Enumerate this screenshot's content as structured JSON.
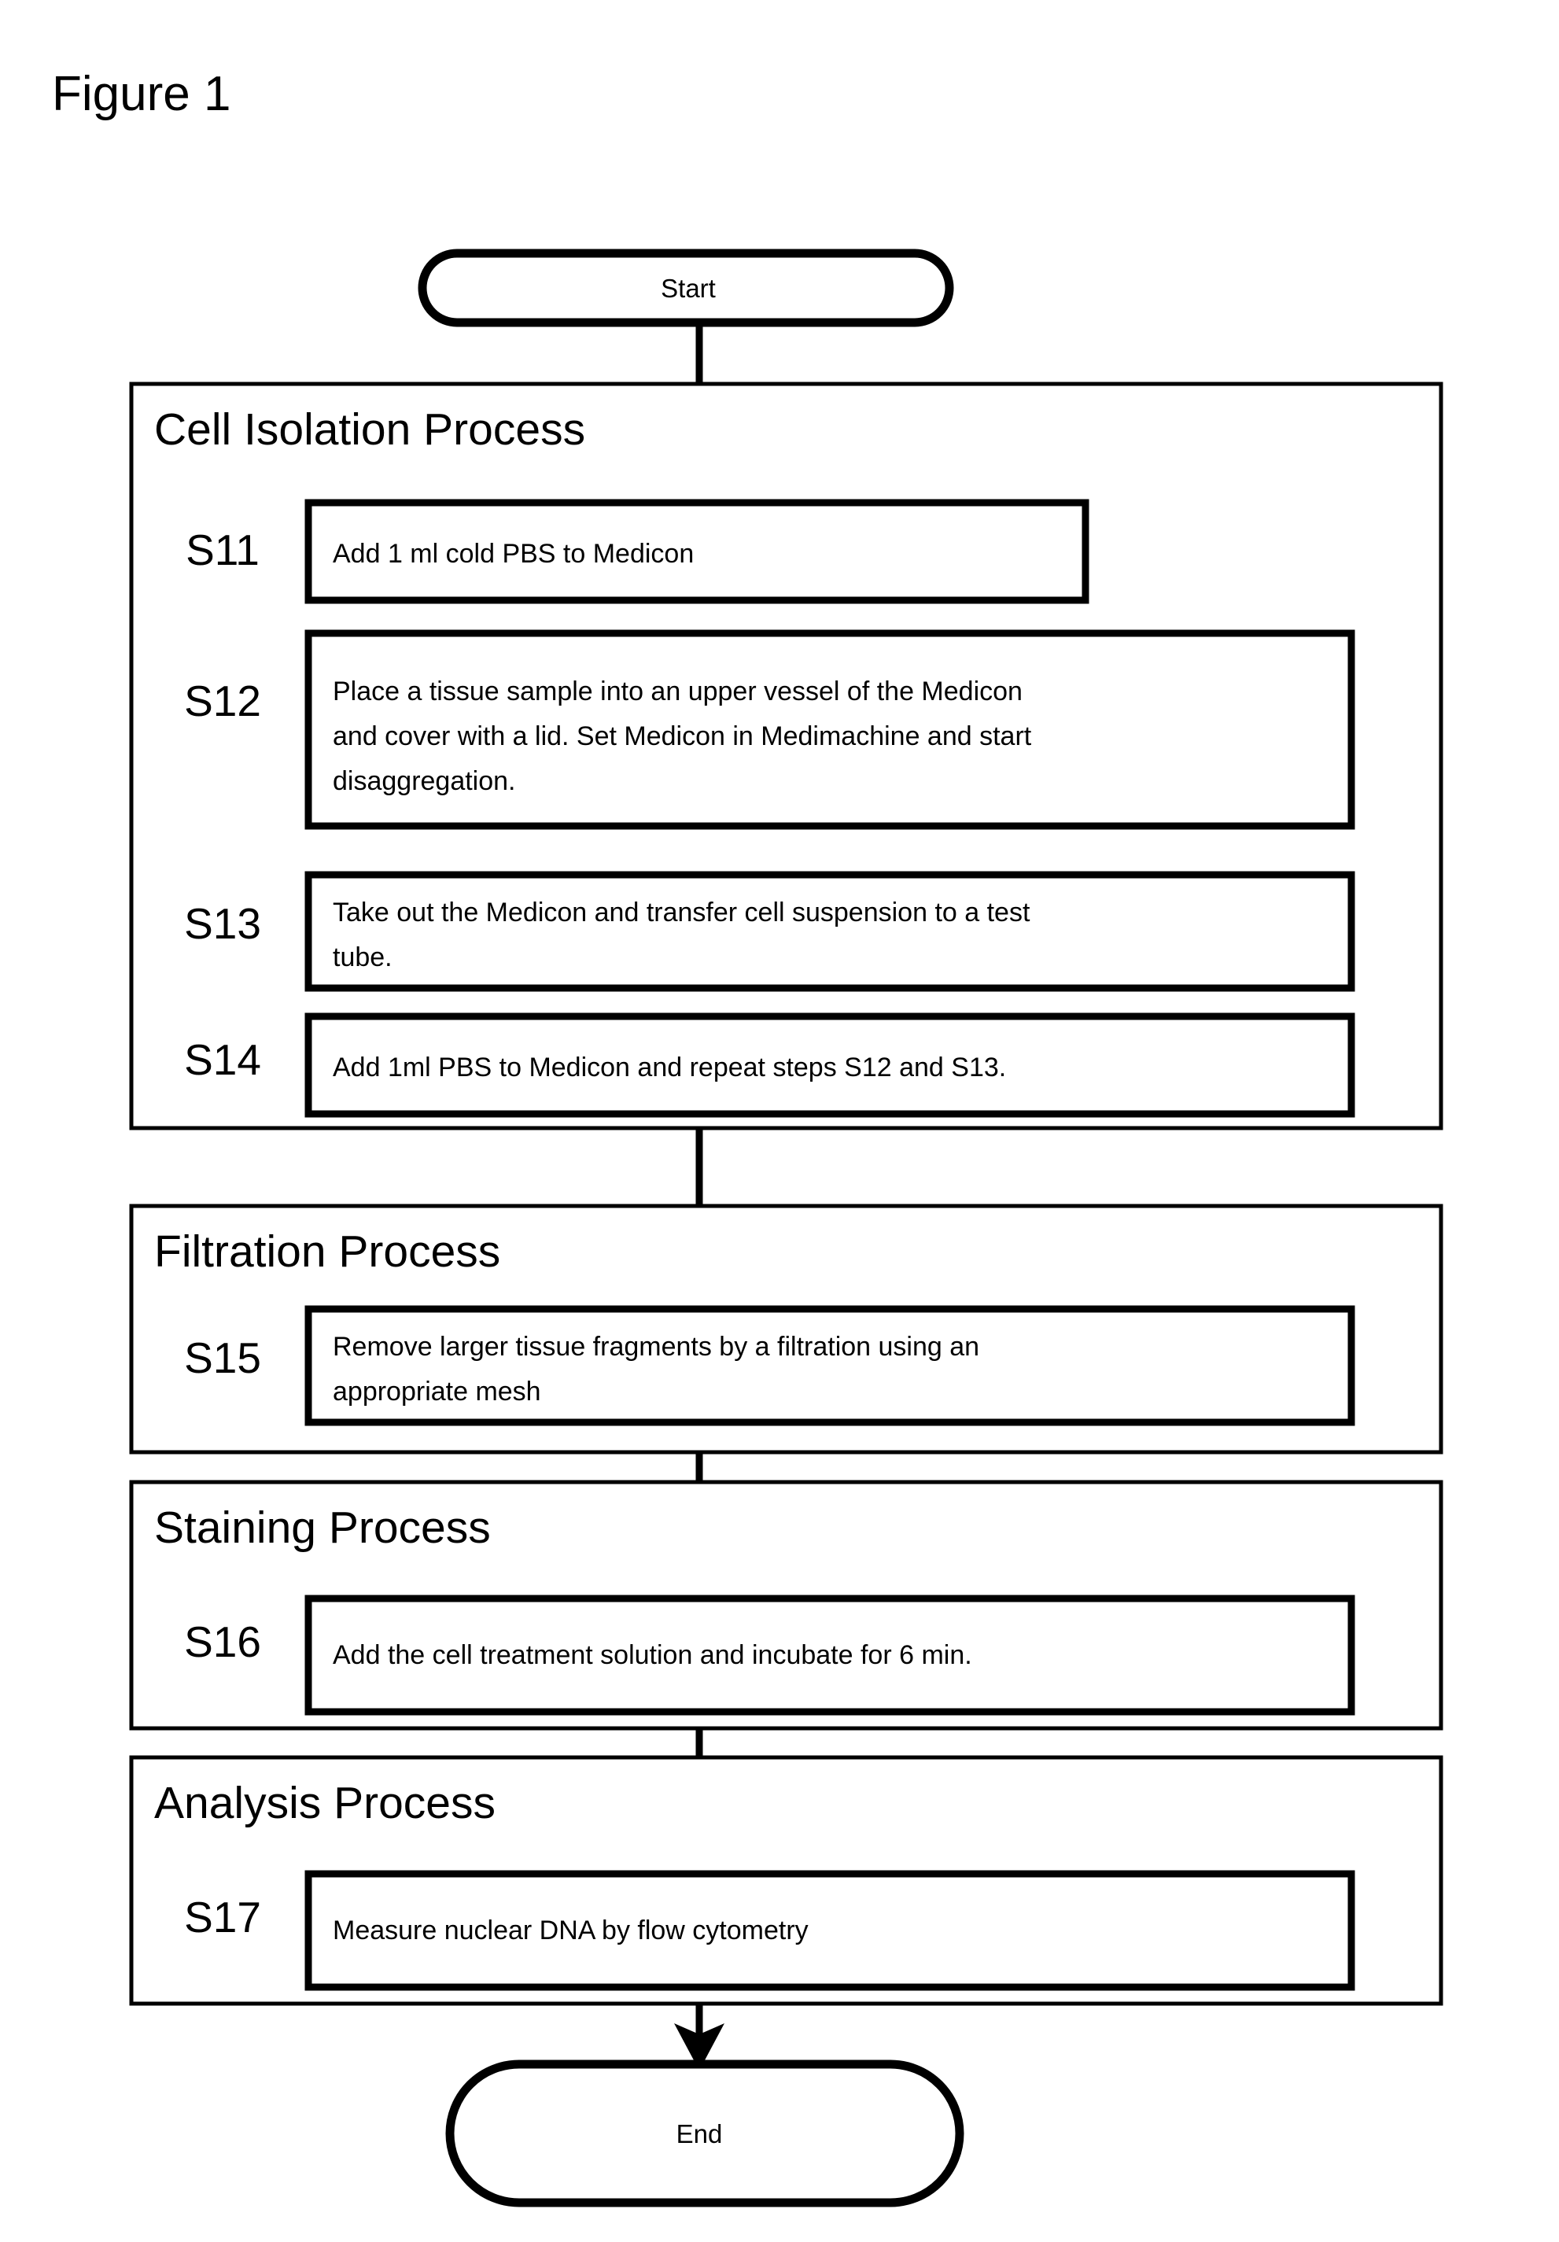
{
  "figure": {
    "title": "Figure 1"
  },
  "terminators": {
    "start": "Start",
    "end": "End"
  },
  "sections": [
    {
      "id": "cell-isolation",
      "title": "Cell Isolation Process",
      "steps": [
        {
          "id": "S11",
          "lines": [
            "Add 1 ml cold PBS to Medicon"
          ]
        },
        {
          "id": "S12",
          "lines": [
            "Place a tissue sample into an upper vessel of the Medicon",
            "and cover with a lid. Set Medicon in Medimachine and start",
            "disaggregation."
          ]
        },
        {
          "id": "S13",
          "lines": [
            "Take out the Medicon and transfer cell suspension to a test",
            "tube."
          ]
        },
        {
          "id": "S14",
          "lines": [
            "Add 1ml PBS to Medicon and repeat steps S12 and S13."
          ]
        }
      ]
    },
    {
      "id": "filtration",
      "title": "Filtration Process",
      "steps": [
        {
          "id": "S15",
          "lines": [
            "Remove larger tissue fragments by a filtration using an",
            "appropriate mesh"
          ]
        }
      ]
    },
    {
      "id": "staining",
      "title": "Staining Process",
      "steps": [
        {
          "id": "S16",
          "lines": [
            "Add the cell treatment solution and incubate for 6 min."
          ]
        }
      ]
    },
    {
      "id": "analysis",
      "title": "Analysis Process",
      "steps": [
        {
          "id": "S17",
          "lines": [
            "Measure nuclear DNA by flow cytometry"
          ]
        }
      ]
    }
  ],
  "colors": {
    "background": "#ffffff",
    "stroke": "#000000",
    "text": "#000000"
  }
}
